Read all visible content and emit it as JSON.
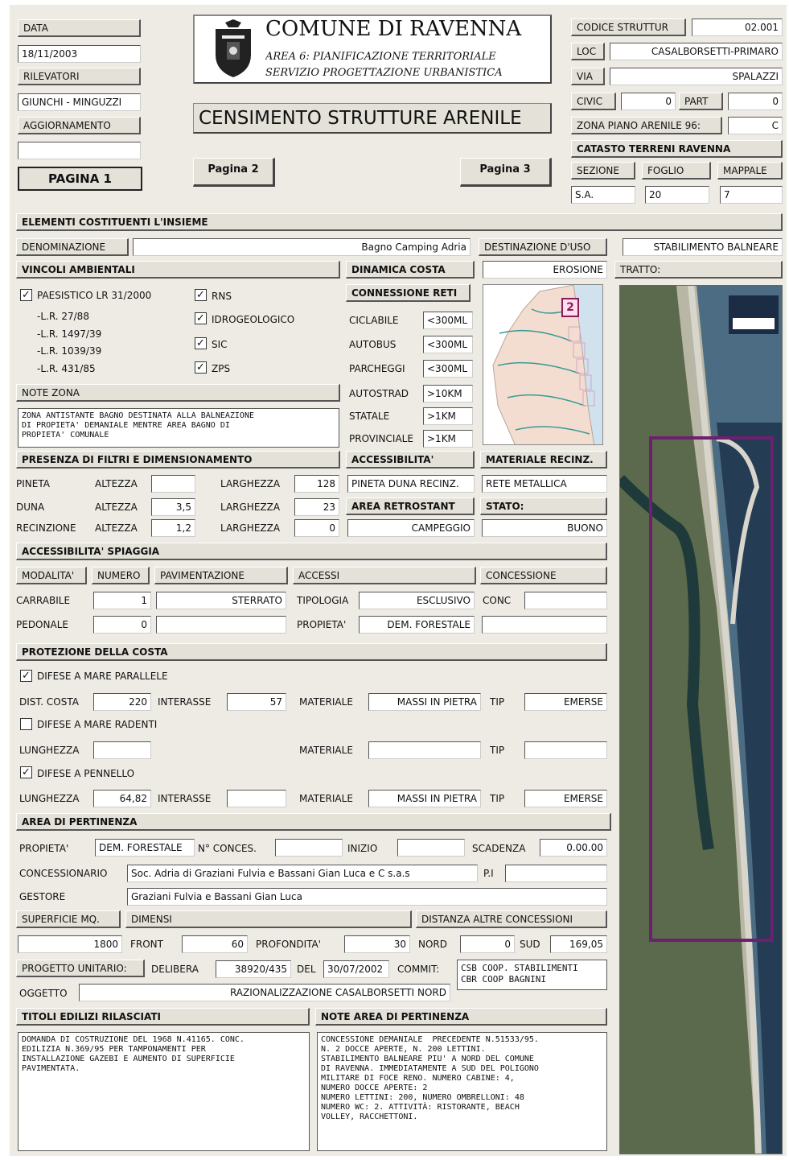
{
  "header": {
    "data_label": "DATA",
    "data_value": "18/11/2003",
    "rilevatori_label": "RILEVATORI",
    "rilevatori_value": "GIUNCHI - MINGUZZI",
    "aggiornamento_label": "AGGIORNAMENTO",
    "aggiornamento_value": "",
    "pagina1": "PAGINA 1",
    "pagina2": "Pagina 2",
    "pagina3": "Pagina 3",
    "comune": "COMUNE DI RAVENNA",
    "area_line1": "AREA 6: PIANIFICAZIONE TERRITORIALE",
    "area_line2": "SERVIZIO PROGETTAZIONE URBANISTICA",
    "title": "CENSIMENTO STRUTTURE ARENILE",
    "codice_label": "CODICE STRUTTUR",
    "codice_value": "02.001",
    "loc_label": "LOC",
    "loc_value": "CASALBORSETTI-PRIMARO",
    "via_label": "VIA",
    "via_value": "SPALAZZI",
    "civic_label": "CIVIC",
    "civic_value": "0",
    "part_label": "PART",
    "part_value": "0",
    "zona_label": "ZONA PIANO ARENILE 96:",
    "zona_value": "C",
    "catasto_label": "CATASTO TERRENI  RAVENNA",
    "sezione_label": "SEZIONE",
    "foglio_label": "FOGLIO",
    "mappale_label": "MAPPALE",
    "sezione_value": "S.A.",
    "foglio_value": "20",
    "mappale_value": "7"
  },
  "elementi": {
    "title": "ELEMENTI COSTITUENTI L'INSIEME",
    "denominazione_label": "DENOMINAZIONE",
    "denominazione_value": "Bagno Camping Adria",
    "destinazione_label": "DESTINAZIONE D'USO",
    "destinazione_value": "STABILIMENTO BALNEARE"
  },
  "vincoli": {
    "title": "VINCOLI AMBIENTALI",
    "paesistico": "PAESISTICO LR 31/2000",
    "lr1": "-L.R. 27/88",
    "lr2": "-L.R. 1497/39",
    "lr3": "-L.R. 1039/39",
    "lr4": "-L.R. 431/85",
    "rns": "RNS",
    "idro": "IDROGEOLOGICO",
    "sic": "SIC",
    "zps": "ZPS",
    "check": "✓"
  },
  "dinamica": {
    "title": "DINAMICA COSTA",
    "value": "EROSIONE",
    "tratto_label": "TRATTO:"
  },
  "reti": {
    "title": "CONNESSIONE RETI",
    "ciclabile": "CICLABILE",
    "ciclabile_v": "<300ML",
    "autobus": "AUTOBUS",
    "autobus_v": "<300ML",
    "parcheggi": "PARCHEGGI",
    "parcheggi_v": "<300ML",
    "autostrad": "AUTOSTRAD",
    "autostrad_v": ">10KM",
    "statale": "STATALE",
    "statale_v": ">1KM",
    "provinciale": "PROVINCIALE",
    "provinciale_v": ">1KM"
  },
  "map": {
    "badge": "2"
  },
  "note_zona": {
    "label": "NOTE ZONA",
    "text": "ZONA ANTISTANTE BAGNO DESTINATA ALLA BALNEAZIONE\nDI PROPIETA' DEMANIALE MENTRE AREA BAGNO DI\nPROPIETA' COMUNALE"
  },
  "filtri": {
    "title": "PRESENZA DI FILTRI E DIMENSIONAMENTO",
    "pineta": "PINETA",
    "duna": "DUNA",
    "recinzione": "RECINZIONE",
    "altezza": "ALTEZZA",
    "larghezza": "LARGHEZZA",
    "pineta_alt": "",
    "pineta_larg": "128",
    "duna_alt": "3,5",
    "duna_larg": "23",
    "rec_alt": "1,2",
    "rec_larg": "0"
  },
  "accessibilita": {
    "title": "ACCESSIBILITA'",
    "value": "PINETA DUNA RECINZ.",
    "area_ret_label": "AREA RETROSTANT",
    "area_ret_value": "CAMPEGGIO"
  },
  "materiale": {
    "title": "MATERIALE RECINZ.",
    "value": "RETE METALLICA",
    "stato_label": "STATO:",
    "stato_value": "BUONO"
  },
  "spiaggia": {
    "title": "ACCESSIBILITA' SPIAGGIA",
    "modalita": "MODALITA'",
    "numero": "NUMERO",
    "pavimentazione": "PAVIMENTAZIONE",
    "accessi": "ACCESSI",
    "concessione": "CONCESSIONE",
    "carrabile": "CARRABILE",
    "carrabile_num": "1",
    "carrabile_pav": "STERRATO",
    "pedonale": "PEDONALE",
    "pedonale_num": "0",
    "pedonale_pav": "",
    "tipologia": "TIPOLOGIA",
    "tipologia_v": "ESCLUSIVO",
    "propieta": "PROPIETA'",
    "propieta_v": "DEM. FORESTALE",
    "conc": "CONC",
    "conc_v": "",
    "conc2_v": ""
  },
  "protezione": {
    "title": "PROTEZIONE DELLA COSTA",
    "parallele": "DIFESE A MARE PARALLELE",
    "dist": "DIST. COSTA",
    "dist_v": "220",
    "interasse": "INTERASSE",
    "interasse1_v": "57",
    "materiale": "MATERIALE",
    "materiale1_v": "MASSI IN PIETRA",
    "tip": "TIP",
    "tip1_v": "EMERSE",
    "radenti": "DIFESE A MARE RADENTI",
    "lunghezza": "LUNGHEZZA",
    "lung2_v": "",
    "materiale2_v": "",
    "tip2_v": "",
    "pennello": "DIFESE A PENNELLO",
    "lung3_v": "64,82",
    "interasse3_v": "",
    "materiale3_v": "MASSI IN PIETRA",
    "tip3_v": "EMERSE",
    "check": "✓"
  },
  "pertinenza": {
    "title": "AREA DI PERTINENZA",
    "propieta": "PROPIETA'",
    "propieta_v": "DEM. FORESTALE",
    "nconces": "N° CONCES.",
    "nconces_v": "",
    "inizio": "INIZIO",
    "inizio_v": "",
    "scadenza": "SCADENZA",
    "scadenza_v": "0.00.00",
    "concessionario": "CONCESSIONARIO",
    "concessionario_v": "Soc. Adria di Graziani Fulvia e Bassani Gian Luca e C s.a.s",
    "pi": "P.I",
    "pi_v": "",
    "gestore": "GESTORE",
    "gestore_v": "Graziani Fulvia e Bassani Gian Luca",
    "superficie": "SUPERFICIE MQ.",
    "superficie_v": "1800",
    "dimensi": "DIMENSI",
    "distanza": "DISTANZA ALTRE CONCESSIONI",
    "front": "FRONT",
    "front_v": "60",
    "profondita": "PROFONDITA'",
    "profondita_v": "30",
    "nord": "NORD",
    "nord_v": "0",
    "sud": "SUD",
    "sud_v": "169,05",
    "progetto": "PROGETTO UNITARIO:",
    "delibera": "DELIBERA",
    "delibera_v": "38920/435",
    "del": "DEL",
    "del_v": "30/07/2002",
    "commit": "COMMIT:",
    "commit_v": "CSB COOP. STABILIMENTI\nCBR COOP BAGNINI",
    "oggetto": "OGGETTO",
    "oggetto_v": "RAZIONALIZZAZIONE CASALBORSETTI NORD"
  },
  "titoli": {
    "title": "TITOLI EDILIZI RILASCIATI",
    "text": "DOMANDA DI COSTRUZIONE DEL 1968 N.41165. CONC.\nEDILIZIA N.369/95 PER TAMPONAMENTI PER\nINSTALLAZIONE GAZEBI E AUMENTO DI SUPERFICIE\nPAVIMENTATA."
  },
  "note_area": {
    "title": "NOTE AREA DI PERTINENZA",
    "text": "CONCESSIONE DEMANIALE  PRECEDENTE N.51533/95.\nN. 2 DOCCE APERTE, N. 200 LETTINI.\nSTABILIMENTO BALNEARE PIU' A NORD DEL COMUNE\nDI RAVENNA. IMMEDIATAMENTE A SUD DEL POLIGONO\nMILITARE DI FOCE RENO. NUMERO CABINE: 4,\nNUMERO DOCCE APERTE: 2\nNUMERO LETTINI: 200, NUMERO OMBRELLONI: 48\nNUMERO WC: 2. ATTIVITÀ: RISTORANTE, BEACH\nVOLLEY, RACCHETTONI."
  },
  "colors": {
    "panel": "#edebe4",
    "frame": "#6f1f6f",
    "sea": "#263e55",
    "beach": "#c7c4b4"
  }
}
